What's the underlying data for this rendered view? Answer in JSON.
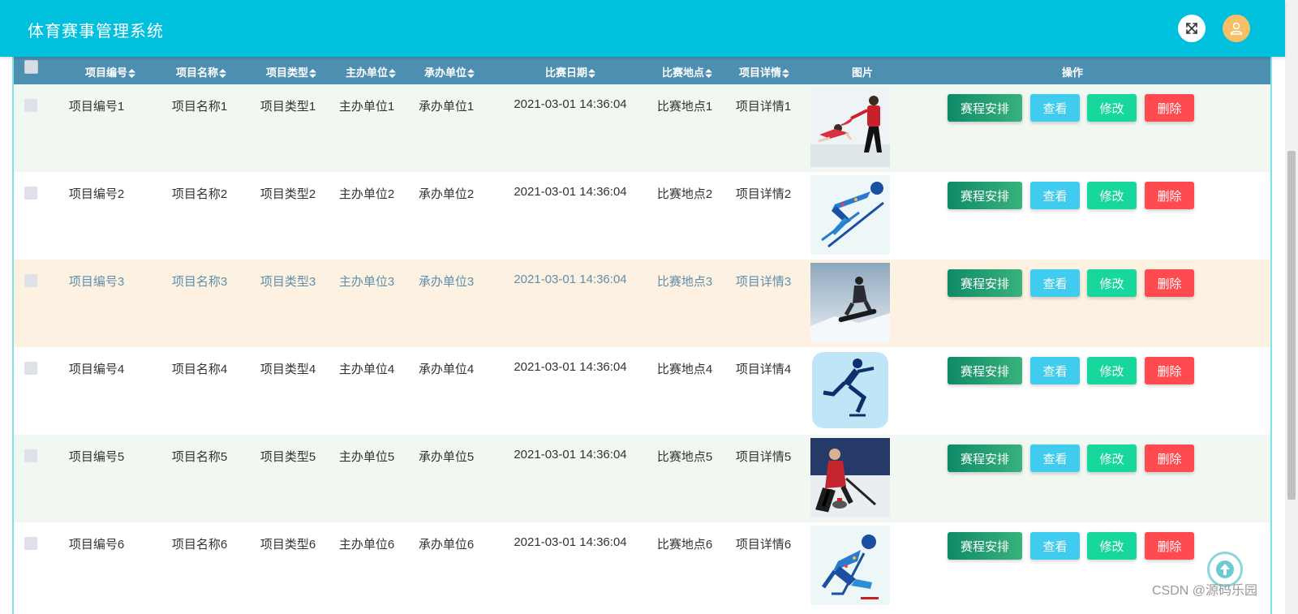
{
  "app": {
    "title": "体育赛事管理系统"
  },
  "header_icons": {
    "fullscreen": "expand-arrows-icon",
    "user": "user-avatar-icon"
  },
  "table": {
    "columns": [
      "项目编号",
      "项目名称",
      "项目类型",
      "主办单位",
      "承办单位",
      "比赛日期",
      "比赛地点",
      "项目详情",
      "图片",
      "操作"
    ],
    "sortable": [
      true,
      true,
      true,
      true,
      true,
      true,
      true,
      true,
      false,
      false
    ],
    "actions": {
      "schedule": "赛程安排",
      "view": "查看",
      "edit": "修改",
      "delete": "删除"
    },
    "rows": [
      {
        "code": "项目编号1",
        "name": "项目名称1",
        "type": "项目类型1",
        "host": "主办单位1",
        "organizer": "承办单位1",
        "date": "2021-03-01 14:36:04",
        "venue": "比赛地点1",
        "detail": "项目详情1",
        "image": "figure-skating-pair"
      },
      {
        "code": "项目编号2",
        "name": "项目名称2",
        "type": "项目类型2",
        "host": "主办单位2",
        "organizer": "承办单位2",
        "date": "2021-03-01 14:36:04",
        "venue": "比赛地点2",
        "detail": "项目详情2",
        "image": "ski-jumping-pictogram"
      },
      {
        "code": "项目编号3",
        "name": "项目名称3",
        "type": "项目类型3",
        "host": "主办单位3",
        "organizer": "承办单位3",
        "date": "2021-03-01 14:36:04",
        "venue": "比赛地点3",
        "detail": "项目详情3",
        "image": "snowboard-jump"
      },
      {
        "code": "项目编号4",
        "name": "项目名称4",
        "type": "项目类型4",
        "host": "主办单位4",
        "organizer": "承办单位4",
        "date": "2021-03-01 14:36:04",
        "venue": "比赛地点4",
        "detail": "项目详情4",
        "image": "speed-skating-pictogram"
      },
      {
        "code": "项目编号5",
        "name": "项目名称5",
        "type": "项目类型5",
        "host": "主办单位5",
        "organizer": "承办单位5",
        "date": "2021-03-01 14:36:04",
        "venue": "比赛地点5",
        "detail": "项目详情5",
        "image": "curling-photo"
      },
      {
        "code": "项目编号6",
        "name": "项目名称6",
        "type": "项目类型6",
        "host": "主办单位6",
        "organizer": "承办单位6",
        "date": "2021-03-01 14:36:04",
        "venue": "比赛地点6",
        "detail": "项目详情6",
        "image": "ice-hockey-pictogram"
      }
    ]
  },
  "watermark": "CSDN @源码乐园",
  "colors": {
    "topbar": "#00c0de",
    "table_header": "#4d8fb1",
    "row_alt": "#f1f7f1",
    "row_highlight": "#fdf1e2",
    "schedule_btn": "#0f8a67",
    "view_btn": "#3fccef",
    "edit_btn": "#17d79c",
    "delete_btn": "#ff4a4f"
  }
}
